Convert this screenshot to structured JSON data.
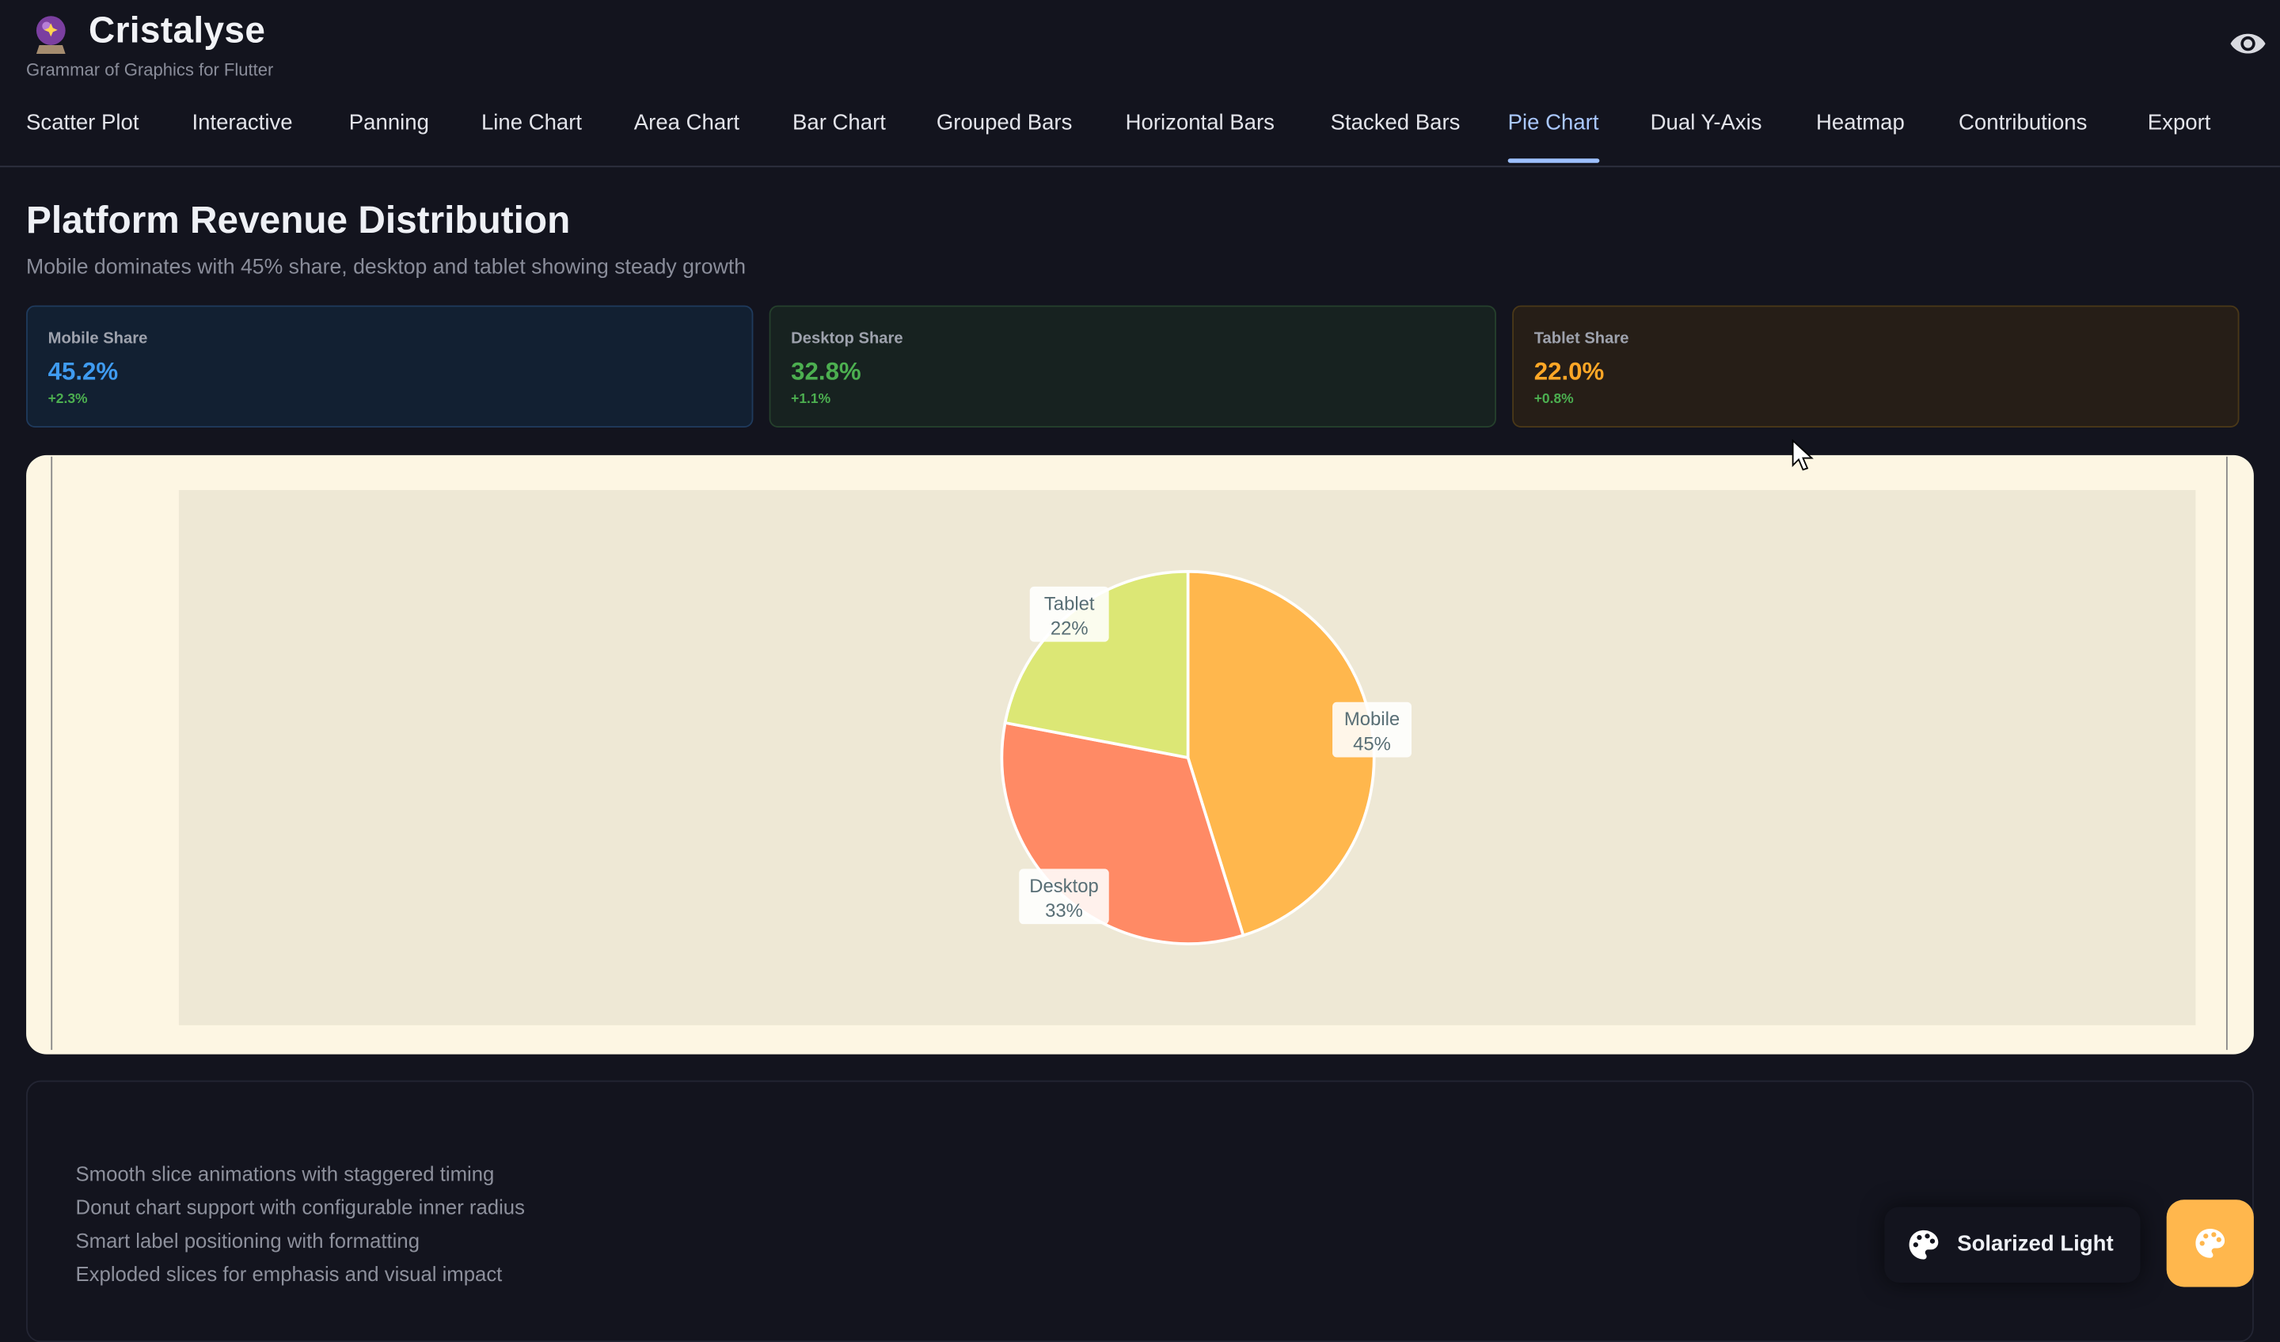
{
  "app": {
    "title": "Cristalyse",
    "subtitle": "Grammar of Graphics for Flutter"
  },
  "icons": {
    "logo": "crystal-ball-icon",
    "visibility": "eye-icon",
    "theme": "palette-icon",
    "pointer": "mouse-cursor-icon"
  },
  "tabs": [
    {
      "label": "Scatter Plot"
    },
    {
      "label": "Interactive"
    },
    {
      "label": "Panning"
    },
    {
      "label": "Line Chart"
    },
    {
      "label": "Area Chart"
    },
    {
      "label": "Bar Chart"
    },
    {
      "label": "Grouped Bars"
    },
    {
      "label": "Horizontal Bars"
    },
    {
      "label": "Stacked Bars"
    },
    {
      "label": "Pie Chart",
      "active": true
    },
    {
      "label": "Dual Y-Axis"
    },
    {
      "label": "Heatmap"
    },
    {
      "label": "Contributions"
    },
    {
      "label": "Export"
    }
  ],
  "page": {
    "title": "Platform Revenue Distribution",
    "subtitle": "Mobile dominates with 45% share, desktop and tablet showing steady growth"
  },
  "stats": [
    {
      "label": "Mobile Share",
      "value": "45.2%",
      "change": "+2.3%",
      "color": "#3f9bf0"
    },
    {
      "label": "Desktop Share",
      "value": "32.8%",
      "change": "+1.1%",
      "color": "#4caf50"
    },
    {
      "label": "Tablet Share",
      "value": "22.0%",
      "change": "+0.8%",
      "color": "#ffa726"
    }
  ],
  "colors": {
    "background": "#13141e",
    "accent": "#9dc0ff",
    "chart_bg": "#fdf6e3",
    "plot_bg": "#eee8d5",
    "fab": "#ffb74d"
  },
  "chart_data": {
    "type": "pie",
    "slices": [
      {
        "label": "Mobile",
        "value": 45.2,
        "display": "45%",
        "color": "#ffb74d"
      },
      {
        "label": "Desktop",
        "value": 32.8,
        "display": "33%",
        "color": "#ff8a65"
      },
      {
        "label": "Tablet",
        "value": 22.0,
        "display": "22%",
        "color": "#dce775"
      }
    ],
    "start": "12 o'clock, clockwise"
  },
  "features": [
    "Smooth slice animations with staggered timing",
    "Donut chart support with configurable inner radius",
    "Smart label positioning with formatting",
    "Exploded slices for emphasis and visual impact"
  ],
  "theme": {
    "label": "Solarized Light"
  }
}
